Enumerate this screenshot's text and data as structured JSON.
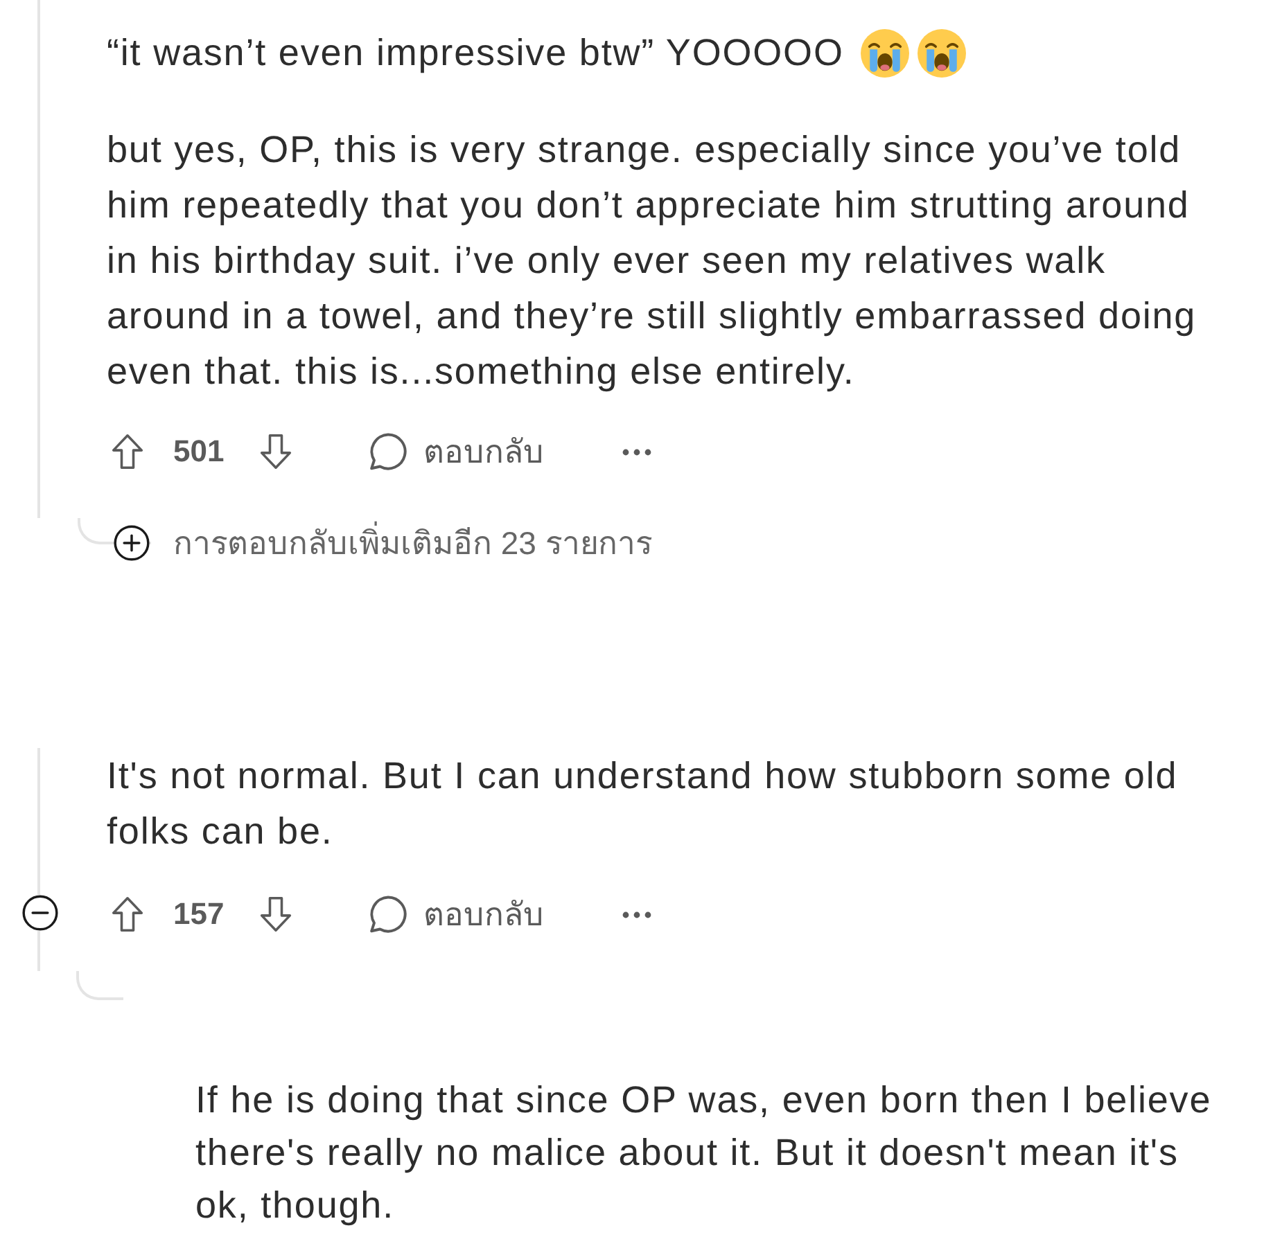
{
  "thread": [
    {
      "paragraphs": [
        {
          "text": "“it wasn’t even impressive btw” YOOOOO",
          "emoji": [
            {
              "kind": "crying"
            },
            {
              "kind": "crying"
            }
          ]
        },
        {
          "text": "but yes, OP, this is very strange. especially since you’ve told him repeatedly that you don’t appreciate him strutting around in his birthday suit. i’ve only ever seen my relatives walk around in a towel, and they’re still slightly embarrassed doing even that. this is...something else entirely."
        }
      ],
      "score": "501",
      "reply_label": "ตอบกลับ",
      "more_replies": "การตอบกลับเพิ่มเติมอีก 23 รายการ"
    },
    {
      "paragraphs": [
        {
          "text": "It's not normal. But I can understand how stubborn some old folks can be."
        }
      ],
      "expanded": true,
      "score": "157",
      "reply_label": "ตอบกลับ",
      "replies": [
        {
          "paragraphs": [
            {
              "text": "If he is doing that since OP was, even born then I believe there's really no malice about it. But it doesn't mean it's ok, though."
            }
          ]
        }
      ]
    }
  ]
}
